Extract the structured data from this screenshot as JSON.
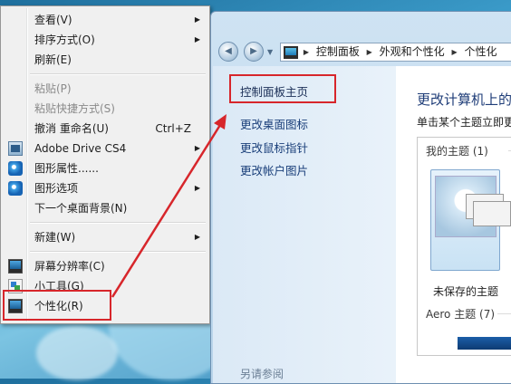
{
  "context_menu": {
    "items": [
      {
        "label": "查看(V)",
        "submenu": true
      },
      {
        "label": "排序方式(O)",
        "submenu": true
      },
      {
        "label": "刷新(E)"
      },
      {
        "label": "粘贴(P)",
        "disabled": true
      },
      {
        "label": "粘贴快捷方式(S)",
        "disabled": true
      },
      {
        "label": "撤消 重命名(U)",
        "shortcut": "Ctrl+Z"
      },
      {
        "label": "Adobe Drive CS4",
        "submenu": true,
        "icon": "adobe-drive-icon"
      },
      {
        "label": "图形属性......",
        "icon": "graphics-properties-icon"
      },
      {
        "label": "图形选项",
        "submenu": true,
        "icon": "graphics-options-icon"
      },
      {
        "label": "下一个桌面背景(N)"
      },
      {
        "label": "新建(W)",
        "submenu": true
      },
      {
        "label": "屏幕分辨率(C)",
        "icon": "screen-resolution-icon"
      },
      {
        "label": "小工具(G)",
        "icon": "gadgets-icon"
      },
      {
        "label": "个性化(R)",
        "icon": "personalize-icon",
        "highlighted": true
      }
    ]
  },
  "window": {
    "breadcrumb": [
      "控制面板",
      "外观和个性化",
      "个性化"
    ],
    "left_links": {
      "home": "控制面板主页",
      "items": [
        "更改桌面图标",
        "更改鼠标指针",
        "更改帐户图片"
      ],
      "see_also": "另请参阅"
    },
    "main": {
      "title": "更改计算机上的",
      "subtitle": "单击某个主题立即更",
      "groups": {
        "my_themes": "我的主题 (1)",
        "aero": "Aero 主题 (7)"
      },
      "unsaved_theme": "未保存的主题"
    }
  },
  "colors": {
    "highlight_red": "#d7262b",
    "link_blue": "#1a3f7a"
  }
}
